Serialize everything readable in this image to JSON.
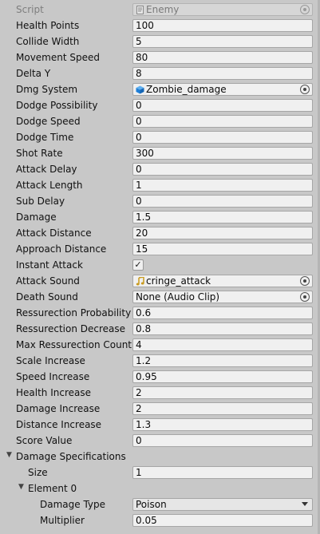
{
  "script": {
    "label": "Script",
    "value": "Enemy"
  },
  "fields": {
    "health_points": {
      "label": "Health Points",
      "value": "100"
    },
    "collide_width": {
      "label": "Collide Width",
      "value": "5"
    },
    "movement_speed": {
      "label": "Movement Speed",
      "value": "80"
    },
    "delta_y": {
      "label": "Delta Y",
      "value": "8"
    },
    "dmg_system": {
      "label": "Dmg System",
      "value": "Zombie_damage",
      "icon": "cube-icon"
    },
    "dodge_possibility": {
      "label": "Dodge Possibility",
      "value": "0"
    },
    "dodge_speed": {
      "label": "Dodge Speed",
      "value": "0"
    },
    "dodge_time": {
      "label": "Dodge Time",
      "value": "0"
    },
    "shot_rate": {
      "label": "Shot Rate",
      "value": "300"
    },
    "attack_delay": {
      "label": "Attack Delay",
      "value": "0"
    },
    "attack_length": {
      "label": "Attack Length",
      "value": "1"
    },
    "sub_delay": {
      "label": "Sub Delay",
      "value": "0"
    },
    "damage": {
      "label": "Damage",
      "value": "1.5"
    },
    "attack_distance": {
      "label": "Attack Distance",
      "value": "20"
    },
    "approach_distance": {
      "label": "Approach Distance",
      "value": "15"
    },
    "instant_attack": {
      "label": "Instant Attack",
      "checked": true,
      "check_glyph": "✓"
    },
    "attack_sound": {
      "label": "Attack Sound",
      "value": "cringe_attack",
      "icon": "audio-note-icon"
    },
    "death_sound": {
      "label": "Death Sound",
      "value": "None (Audio Clip)"
    },
    "ressurection_probability": {
      "label": "Ressurection Probability",
      "value": "0.6"
    },
    "ressurection_decrease": {
      "label": "Ressurection Decrease",
      "value": "0.8"
    },
    "max_ressurection_count": {
      "label": "Max Ressurection Count",
      "value": "4"
    },
    "scale_increase": {
      "label": "Scale Increase",
      "value": "1.2"
    },
    "speed_increase": {
      "label": "Speed Increase",
      "value": "0.95"
    },
    "health_increase": {
      "label": "Health Increase",
      "value": "2"
    },
    "damage_increase": {
      "label": "Damage Increase",
      "value": "2"
    },
    "distance_increase": {
      "label": "Distance Increase",
      "value": "1.3"
    },
    "score_value": {
      "label": "Score Value",
      "value": "0"
    }
  },
  "damage_specifications": {
    "label": "Damage Specifications",
    "expanded": true,
    "size": {
      "label": "Size",
      "value": "1"
    },
    "element0": {
      "label": "Element 0",
      "expanded": true,
      "damage_type": {
        "label": "Damage Type",
        "value": "Poison"
      },
      "multiplier": {
        "label": "Multiplier",
        "value": "0.05"
      }
    }
  },
  "colors": {
    "panel": "#c8c8c8",
    "field": "#f0f0f0",
    "cube_icon": "#1e7fd8",
    "note_icon": "#c99a1e"
  }
}
